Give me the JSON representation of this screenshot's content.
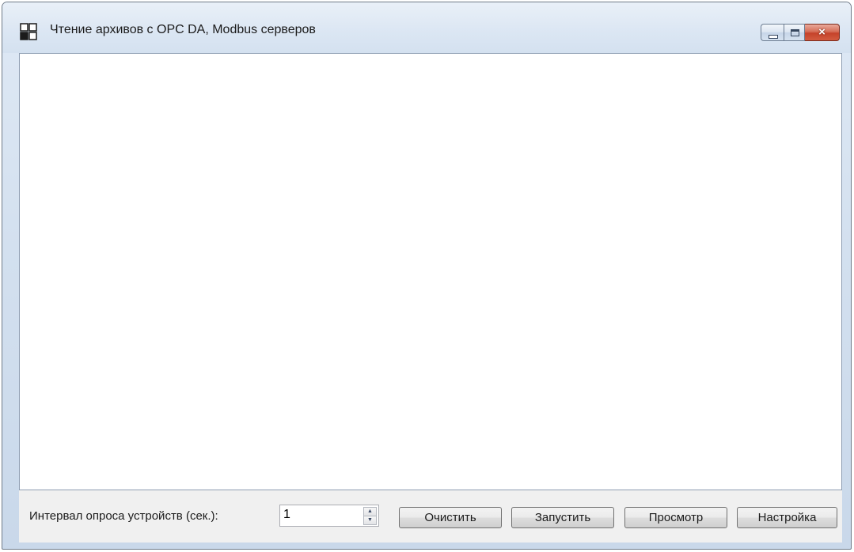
{
  "window": {
    "title": "Чтение архивов с OPC DA, Modbus серверов",
    "icon": "app-grid-icon",
    "controls": {
      "minimize": "minimize-icon",
      "maximize": "maximize-icon",
      "close": "×"
    },
    "close_color": "#c5432b"
  },
  "bottom": {
    "interval_label": "Интервал опроса устройств (сек.):",
    "interval_value": "1",
    "buttons": {
      "clear": "Очистить",
      "start": "Запустить",
      "view": "Просмотр",
      "setup": "Настройка"
    }
  }
}
